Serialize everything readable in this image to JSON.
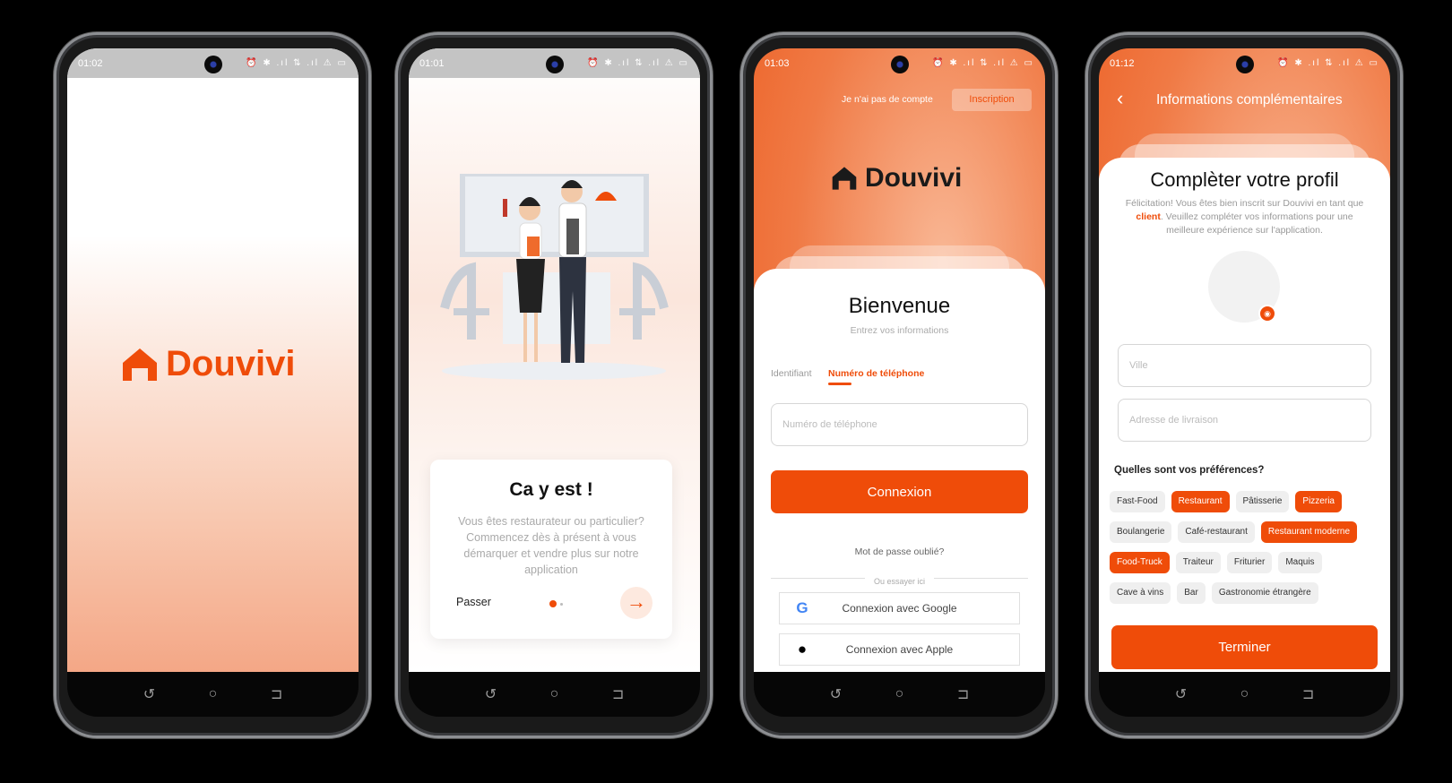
{
  "brand": {
    "name": "Douvivi",
    "accent": "#ef4c09"
  },
  "phones": [
    {
      "time": "01:02",
      "status_icons": "⏰ ✱ .ıl ⇅ .ıl ⚠ ▭"
    },
    {
      "time": "01:01",
      "status_icons": "⏰ ✱ .ıl ⇅ .ıl ⚠ ▭"
    },
    {
      "time": "01:03",
      "status_icons": "⏰ ✱ .ıl ⇅ .ıl ⚠ ▭"
    },
    {
      "time": "01:12",
      "status_icons": "⏰ ✱ .ıl ⇅ .ıl ⚠ ▭"
    }
  ],
  "onboarding": {
    "title": "Ca y est !",
    "text": "Vous êtes restaurateur ou particulier? Commencez dès à présent à vous démarquer et vendre plus sur notre application",
    "skip": "Passer"
  },
  "login": {
    "no_account": "Je n'ai pas de compte",
    "signup": "Inscription",
    "title": "Bienvenue",
    "subtitle": "Entrez vos informations",
    "tabs": [
      "Identifiant",
      "Numéro de téléphone"
    ],
    "phone_placeholder": "Numéro de téléphone",
    "submit": "Connexion",
    "forgot": "Mot de passe oublié?",
    "or": "Ou essayer ici",
    "google": "Connexion avec Google",
    "apple": "Connexion avec Apple"
  },
  "profile": {
    "header": "Informations complémentaires",
    "title": "Complèter votre profil",
    "desc_1": "Félicitation! Vous êtes bien inscrit sur Douvivi en tant que ",
    "desc_role": "client",
    "desc_2": ". Veuillez compléter vos informations pour une meilleure expérience sur l'application.",
    "city_placeholder": "Ville",
    "address_placeholder": "Adresse de livraison",
    "prefs_label": "Quelles sont vos préférences?",
    "prefs": [
      [
        {
          "label": "Fast-Food",
          "selected": false
        },
        {
          "label": "Restaurant",
          "selected": true
        },
        {
          "label": "Pâtisserie",
          "selected": false
        },
        {
          "label": "Pizzeria",
          "selected": true
        }
      ],
      [
        {
          "label": "Boulangerie",
          "selected": false
        },
        {
          "label": "Café-restaurant",
          "selected": false
        },
        {
          "label": "Restaurant moderne",
          "selected": true
        }
      ],
      [
        {
          "label": "Food-Truck",
          "selected": true
        },
        {
          "label": "Traiteur",
          "selected": false
        },
        {
          "label": "Friturier",
          "selected": false
        },
        {
          "label": "Maquis",
          "selected": false
        }
      ],
      [
        {
          "label": "Cave à vins",
          "selected": false
        },
        {
          "label": "Bar",
          "selected": false
        },
        {
          "label": "Gastronomie étrangère",
          "selected": false
        }
      ]
    ],
    "finish": "Terminer"
  }
}
